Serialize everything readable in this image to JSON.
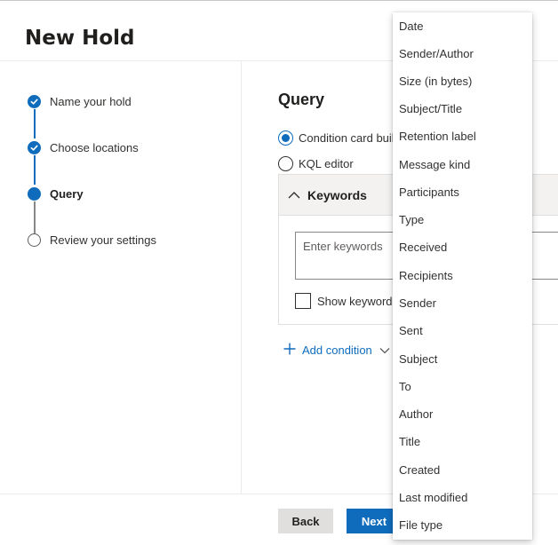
{
  "page": {
    "title": "New Hold"
  },
  "steps": [
    {
      "label": "Name your hold",
      "state": "done"
    },
    {
      "label": "Choose locations",
      "state": "done"
    },
    {
      "label": "Query",
      "state": "current"
    },
    {
      "label": "Review your settings",
      "state": "pending"
    }
  ],
  "query": {
    "heading": "Query",
    "options": [
      {
        "label": "Condition card builder",
        "selected": true
      },
      {
        "label": "KQL editor",
        "selected": false
      }
    ],
    "card": {
      "title": "Keywords",
      "keywords_placeholder": "Enter keywords",
      "keywords_value": "",
      "show_keyword_list_label": "Show keyword list",
      "show_keyword_list_checked": false
    },
    "add_condition_label": "Add condition"
  },
  "condition_menu": {
    "items": [
      "Date",
      "Sender/Author",
      "Size (in bytes)",
      "Subject/Title",
      "Retention label",
      "Message kind",
      "Participants",
      "Type",
      "Received",
      "Recipients",
      "Sender",
      "Sent",
      "Subject",
      "To",
      "Author",
      "Title",
      "Created",
      "Last modified",
      "File type"
    ]
  },
  "footer": {
    "back_label": "Back",
    "next_label": "Next"
  },
  "colors": {
    "accent": "#0f6cbd",
    "text": "#323130",
    "separator": "#edebe9"
  },
  "icons": {
    "step_done": "check-circle-icon",
    "step_current": "filled-circle-icon",
    "step_pending": "empty-circle-icon",
    "card_toggle": "chevron-up-icon",
    "add": "plus-icon",
    "add_dropdown": "chevron-down-icon"
  }
}
